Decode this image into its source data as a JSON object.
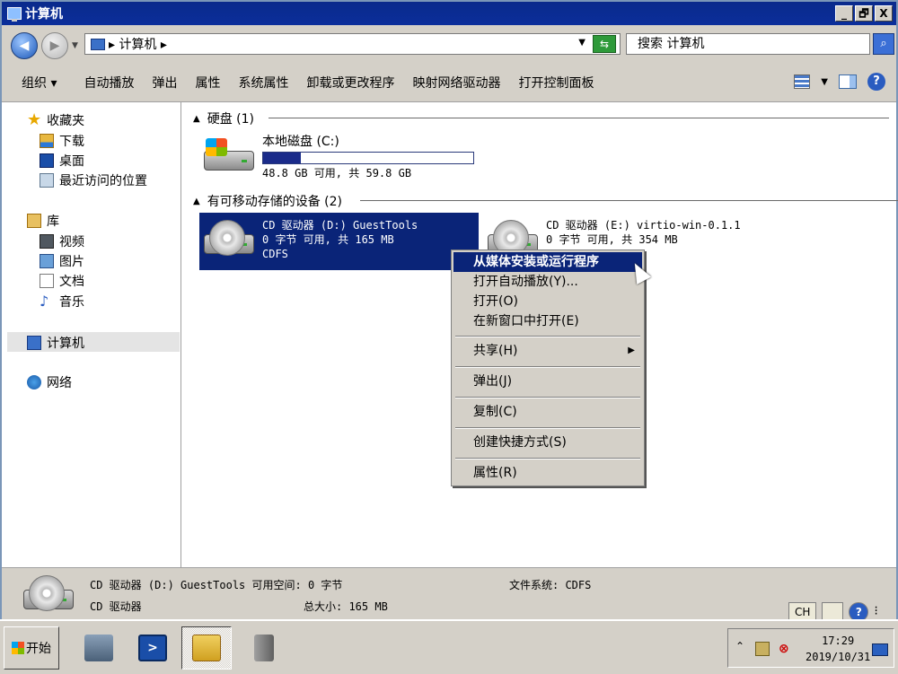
{
  "window": {
    "title": "计算机",
    "controls": [
      "_",
      "🗗",
      "X"
    ]
  },
  "address": {
    "back_icon": "back-arrow-icon",
    "forward_icon": "forward-arrow-icon",
    "path": "▸ 计算机 ▸",
    "go_icon": "refresh-icon",
    "search_placeholder": "搜索 计算机"
  },
  "toolbar": {
    "organize": "组织 ▾",
    "autoplay": "自动播放",
    "eject": "弹出",
    "properties": "属性",
    "system_properties": "系统属性",
    "uninstall": "卸载或更改程序",
    "map_drive": "映射网络驱动器",
    "control_panel": "打开控制面板",
    "help": "?"
  },
  "nav": {
    "favorites": "收藏夹",
    "downloads": "下载",
    "desktop": "桌面",
    "recent": "最近访问的位置",
    "libraries": "库",
    "videos": "视频",
    "pictures": "图片",
    "documents": "文档",
    "music": "音乐",
    "computer": "计算机",
    "network": "网络"
  },
  "groups": {
    "hdd": "硬盘 (1)",
    "removable": "有可移动存储的设备 (2)"
  },
  "drives": {
    "c": {
      "name": "本地磁盘 (C:)",
      "free_text": "48.8 GB 可用, 共 59.8 GB",
      "used_fraction": 0.18
    },
    "d": {
      "name": "CD 驱动器 (D:) GuestTools",
      "free_text": "0 字节 可用, 共 165 MB",
      "fs": "CDFS"
    },
    "e": {
      "name": "CD 驱动器 (E:) virtio-win-0.1.1",
      "free_text": "0 字节 可用, 共 354 MB"
    }
  },
  "context_menu": {
    "install": "从媒体安装或运行程序",
    "autoplay": "打开自动播放(Y)...",
    "open": "打开(O)",
    "open_new": "在新窗口中打开(E)",
    "share": "共享(H)",
    "eject": "弹出(J)",
    "copy": "复制(C)",
    "shortcut": "创建快捷方式(S)",
    "properties": "属性(R)"
  },
  "details": {
    "name_line": "CD 驱动器 (D:) GuestTools 可用空间: 0 字节",
    "type": "CD 驱动器",
    "total": "总大小: 165 MB",
    "filesystem": "文件系统: CDFS",
    "lang": "CH"
  },
  "taskbar": {
    "start": "开始",
    "time": "17:29",
    "date": "2019/10/31"
  }
}
